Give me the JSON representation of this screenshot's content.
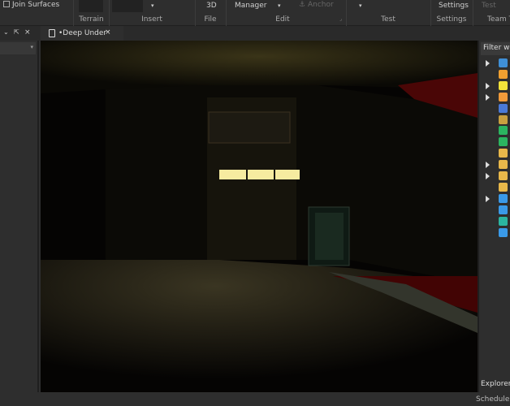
{
  "ribbon": {
    "join_surfaces": "Join Surfaces",
    "terrain": "Terrain",
    "insert": "Insert",
    "three_d": "3D",
    "file": "File",
    "manager": "Manager",
    "anchor": "Anchor",
    "edit": "Edit",
    "test": "Test",
    "settings_btn": "Settings",
    "settings": "Settings",
    "test_btn": "Test",
    "team_test": "Team T"
  },
  "tab": {
    "label": "•Deep Under",
    "close": "×"
  },
  "left_panel": {
    "close": "×"
  },
  "right_panel": {
    "filter_placeholder": "Filter wo",
    "explorer": "Explorer",
    "items": [
      {
        "icon": "workspace-icon",
        "color": "#3f8fd6",
        "expand": true
      },
      {
        "icon": "players-icon",
        "color": "#f0a030",
        "expand": false
      },
      {
        "icon": "lighting-icon",
        "color": "#f2e23a",
        "expand": true
      },
      {
        "icon": "material-service-icon",
        "color": "#f09a3a",
        "expand": true
      },
      {
        "icon": "network-client-icon",
        "color": "#4a7ad8",
        "expand": false
      },
      {
        "icon": "replicated-first-icon",
        "color": "#c9a040",
        "expand": false
      },
      {
        "icon": "replicated-storage-icon",
        "color": "#2bb560",
        "expand": false
      },
      {
        "icon": "server-script-service-icon",
        "color": "#2bb560",
        "expand": false
      },
      {
        "icon": "server-storage-icon",
        "color": "#e8b84a",
        "expand": false
      },
      {
        "icon": "starter-gui-icon",
        "color": "#e8b84a",
        "expand": true
      },
      {
        "icon": "starter-pack-icon",
        "color": "#e8b84a",
        "expand": true
      },
      {
        "icon": "starter-player-icon",
        "color": "#e8b84a",
        "expand": false
      },
      {
        "icon": "sound-service-icon",
        "color": "#3a9ae8",
        "expand": true
      },
      {
        "icon": "chat-icon",
        "color": "#3a9ae8",
        "expand": false
      },
      {
        "icon": "localization-icon",
        "color": "#2bb5a0",
        "expand": false
      },
      {
        "icon": "test-service-icon",
        "color": "#3a9ae8",
        "expand": false
      }
    ]
  },
  "status": {
    "scheduler": "Scheduler:"
  }
}
